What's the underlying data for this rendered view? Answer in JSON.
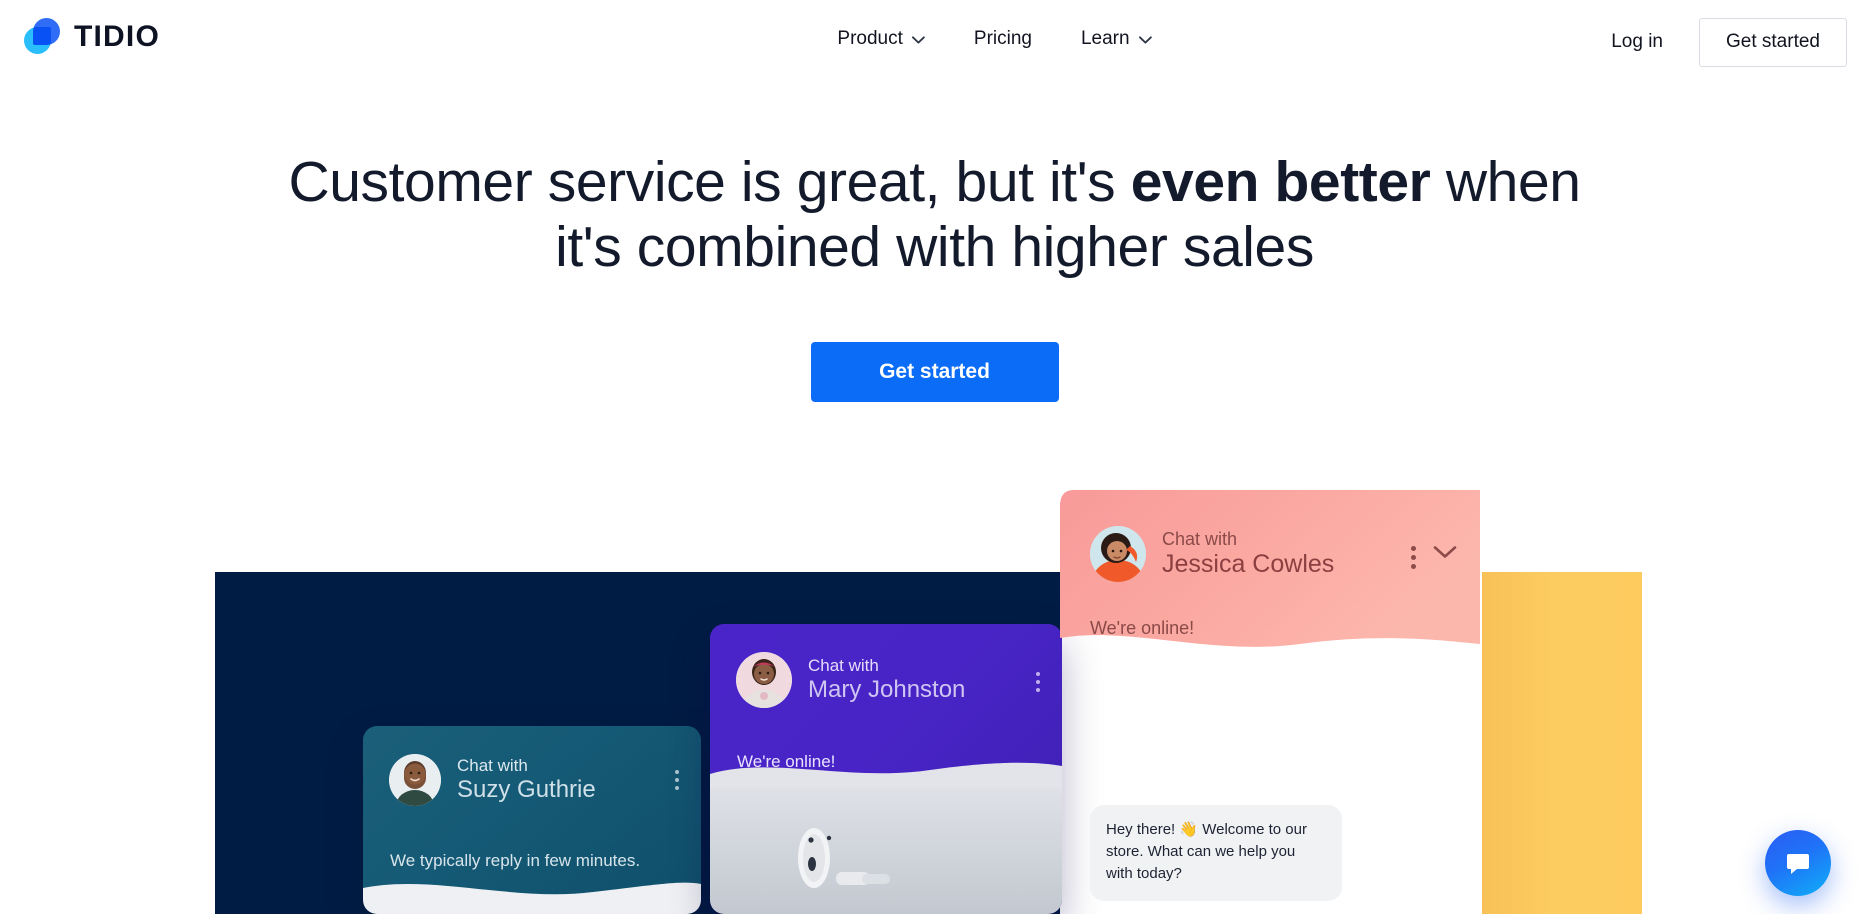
{
  "brand": {
    "name": "TIDIO",
    "logo_icon": "tidio-chat-drop-logo",
    "colors": {
      "primary_blue": "#0b6cf7",
      "logo_dark_blue": "#2f6df6",
      "logo_light_blue": "#17b9fd",
      "navy_panel": "#001c44",
      "yellow_panel": "#fbc95c",
      "purple_card": "#4a24c8",
      "teal_card": "#155a76",
      "pink_card": "#f79a99",
      "text_dark": "#131a2b"
    }
  },
  "header": {
    "nav": [
      {
        "label": "Product",
        "has_dropdown": true,
        "icon": "chevron-down-icon"
      },
      {
        "label": "Pricing",
        "has_dropdown": false,
        "icon": ""
      },
      {
        "label": "Learn",
        "has_dropdown": true,
        "icon": "chevron-down-icon"
      }
    ],
    "login_label": "Log in",
    "get_started_label": "Get started"
  },
  "hero": {
    "title_part1": "Customer service is great, but it's ",
    "title_bold": "even better",
    "title_part2": " when it's combined with higher sales",
    "cta_label": "Get started"
  },
  "chat_cards": [
    {
      "id": "suzy",
      "prefix": "Chat with",
      "name": "Suzy Guthrie",
      "status": "We typically reply in few minutes.",
      "menu_icon": "kebab-menu-icon",
      "avatar_icon": "avatar-suzy"
    },
    {
      "id": "mary",
      "prefix": "Chat with",
      "name": "Mary Johnston",
      "status": "We're online!",
      "menu_icon": "kebab-menu-icon",
      "avatar_icon": "avatar-mary"
    },
    {
      "id": "jessica",
      "prefix": "Chat with",
      "name": "Jessica Cowles",
      "status": "We're online!",
      "menu_icon": "kebab-menu-icon",
      "collapse_icon": "chevron-down-icon",
      "avatar_icon": "avatar-jessica",
      "message": "Hey there! 👋 Welcome to our store. What can we help you with today?"
    }
  ],
  "launcher": {
    "icon": "chat-bubble-icon",
    "label": "Open chat"
  }
}
